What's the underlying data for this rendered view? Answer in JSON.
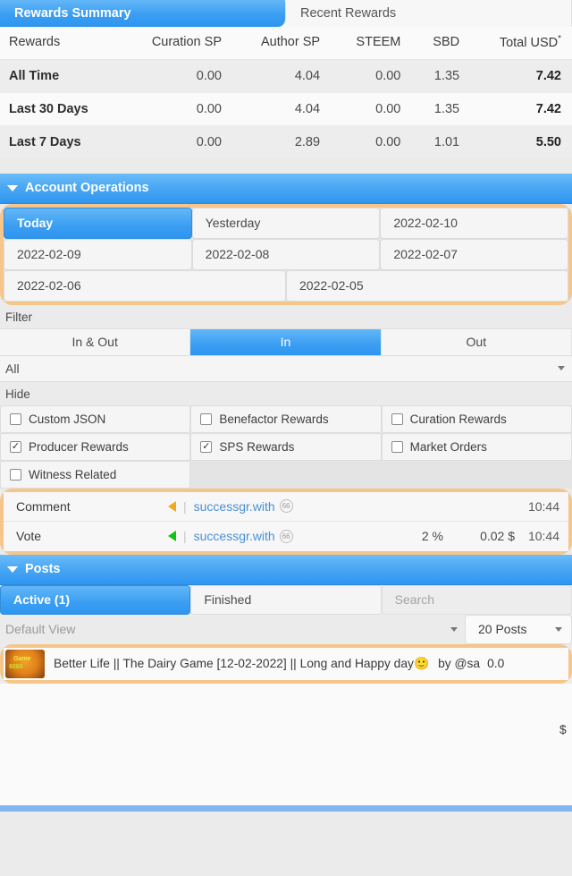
{
  "tabs": [
    {
      "label": "Rewards Summary",
      "active": true
    },
    {
      "label": "Recent Rewards",
      "active": false
    }
  ],
  "rewards_table": {
    "columns": [
      "Rewards",
      "Curation SP",
      "Author SP",
      "STEEM",
      "SBD",
      "Total USD"
    ],
    "total_suffix": "*",
    "rows": [
      {
        "label": "All Time",
        "curation_sp": "0.00",
        "author_sp": "4.04",
        "steem": "0.00",
        "sbd": "1.35",
        "total_usd": "7.42"
      },
      {
        "label": "Last 30 Days",
        "curation_sp": "0.00",
        "author_sp": "4.04",
        "steem": "0.00",
        "sbd": "1.35",
        "total_usd": "7.42"
      },
      {
        "label": "Last 7 Days",
        "curation_sp": "0.00",
        "author_sp": "2.89",
        "steem": "0.00",
        "sbd": "1.01",
        "total_usd": "5.50"
      }
    ]
  },
  "account_operations": {
    "title": "Account Operations",
    "dates": [
      {
        "label": "Today",
        "active": true
      },
      {
        "label": "Yesterday",
        "active": false
      },
      {
        "label": "2022-02-10",
        "active": false
      },
      {
        "label": "2022-02-09",
        "active": false
      },
      {
        "label": "2022-02-08",
        "active": false
      },
      {
        "label": "2022-02-07",
        "active": false
      },
      {
        "label": "2022-02-06",
        "active": false
      },
      {
        "label": "2022-02-05",
        "active": false
      }
    ],
    "filter_label": "Filter",
    "direction": [
      {
        "label": "In & Out",
        "active": false
      },
      {
        "label": "In",
        "active": true
      },
      {
        "label": "Out",
        "active": false
      }
    ],
    "type_select": "All",
    "hide_label": "Hide",
    "hide_options": [
      {
        "label": "Custom JSON",
        "checked": false
      },
      {
        "label": "Benefactor Rewards",
        "checked": false
      },
      {
        "label": "Curation Rewards",
        "checked": false
      },
      {
        "label": "Producer Rewards",
        "checked": true
      },
      {
        "label": "SPS Rewards",
        "checked": true
      },
      {
        "label": "Market Orders",
        "checked": false
      },
      {
        "label": "Witness Related",
        "checked": false
      }
    ],
    "operations": [
      {
        "type": "Comment",
        "direction_color": "#f0a91e",
        "account": "successgr.with",
        "reputation": "66",
        "percent": "",
        "amount": "",
        "time": "10:44"
      },
      {
        "type": "Vote",
        "direction_color": "#12c412",
        "account": "successgr.with",
        "reputation": "66",
        "percent": "2 %",
        "amount": "0.02 $",
        "time": "10:44"
      }
    ]
  },
  "posts": {
    "title": "Posts",
    "tabs": [
      {
        "label": "Active (1)",
        "active": true
      },
      {
        "label": "Finished",
        "active": false
      }
    ],
    "search_placeholder": "Search",
    "view_select": "Default View",
    "count_select": "20 Posts",
    "items": [
      {
        "title": "Better Life || The Dairy Game [12-02-2022] || Long and Happy day",
        "emoji": "🙂",
        "byline": "by @sa",
        "value": "0.0",
        "currency": "$",
        "thumbnail_line1": "Game",
        "thumbnail_line2": "6060"
      }
    ]
  },
  "colors": {
    "accent_blue": "#2e95f0",
    "highlight_orange": "#f6c58a",
    "link_blue": "#4a8fd6",
    "bottom_bar": "#82b6ef"
  }
}
